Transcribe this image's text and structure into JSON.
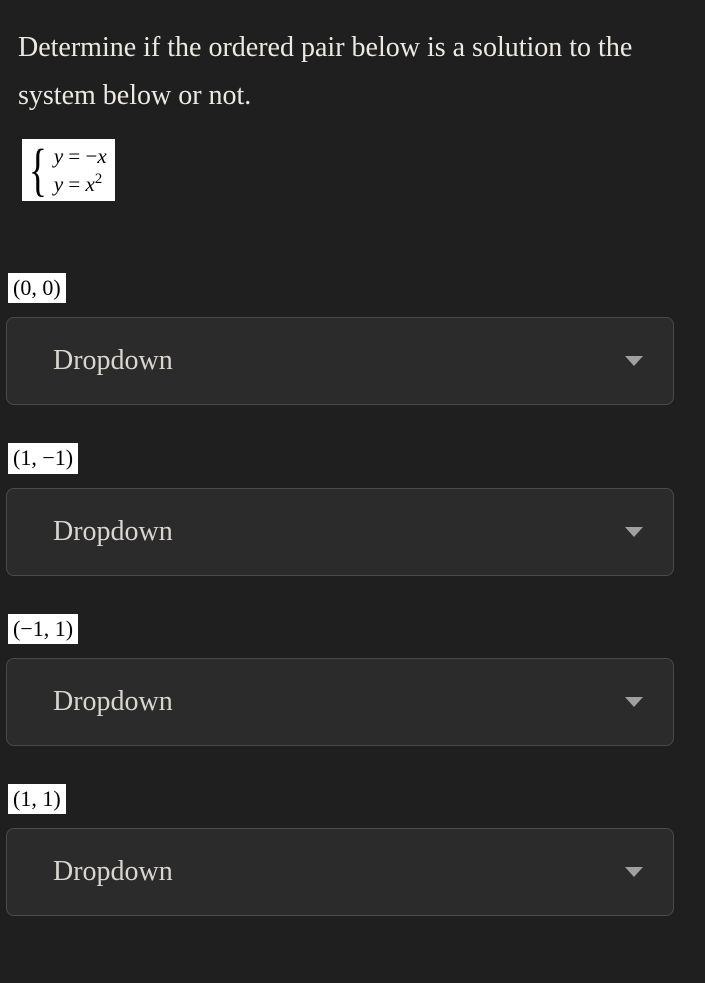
{
  "question": {
    "prompt": "Determine if the ordered pair below is a solution to the system below or not.",
    "system": {
      "eq1_lhs": "y",
      "eq1_op": " = ",
      "eq1_rhs_sign": "−",
      "eq1_rhs_var": "x",
      "eq2_lhs": "y",
      "eq2_op": " = ",
      "eq2_rhs_var": "x",
      "eq2_rhs_exp": "2"
    }
  },
  "items": [
    {
      "pair": "(0, 0)",
      "dropdown_label": "Dropdown"
    },
    {
      "pair": "(1, −1)",
      "dropdown_label": "Dropdown"
    },
    {
      "pair": "(−1, 1)",
      "dropdown_label": "Dropdown"
    },
    {
      "pair": "(1, 1)",
      "dropdown_label": "Dropdown"
    }
  ]
}
